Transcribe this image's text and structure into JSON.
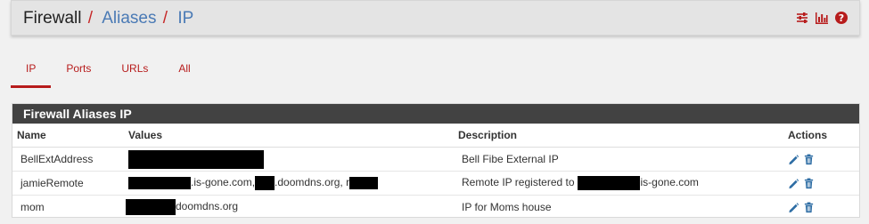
{
  "breadcrumb": {
    "root": "Firewall",
    "separator": "/",
    "aliases": "Aliases",
    "current": "IP"
  },
  "header_icons": [
    "sliders-icon",
    "bar-chart-icon",
    "help-icon"
  ],
  "tabs": [
    {
      "label": "IP",
      "active": true
    },
    {
      "label": "Ports",
      "active": false
    },
    {
      "label": "URLs",
      "active": false
    },
    {
      "label": "All",
      "active": false
    }
  ],
  "panel": {
    "title": "Firewall Aliases IP",
    "columns": [
      "Name",
      "Values",
      "Description",
      "Actions"
    ],
    "rows": [
      {
        "name": "BellExtAddress",
        "values_text": "",
        "description_pre": "Bell Fibe External IP",
        "description_post": ""
      },
      {
        "name": "jamieRemote",
        "values_text_1": ".is-gone.com,",
        "values_text_2": ".doomdns.org, r",
        "description_pre": "Remote IP registered to",
        "description_post": "is-gone.com"
      },
      {
        "name": "mom",
        "values_text": "doomdns.org",
        "description_pre": "IP for Moms house",
        "description_post": ""
      }
    ]
  },
  "colors": {
    "accent_red": "#b71c1c",
    "link_blue": "#4a7ab5",
    "panel_header": "#424242",
    "icon_blue": "#2e6da4"
  }
}
